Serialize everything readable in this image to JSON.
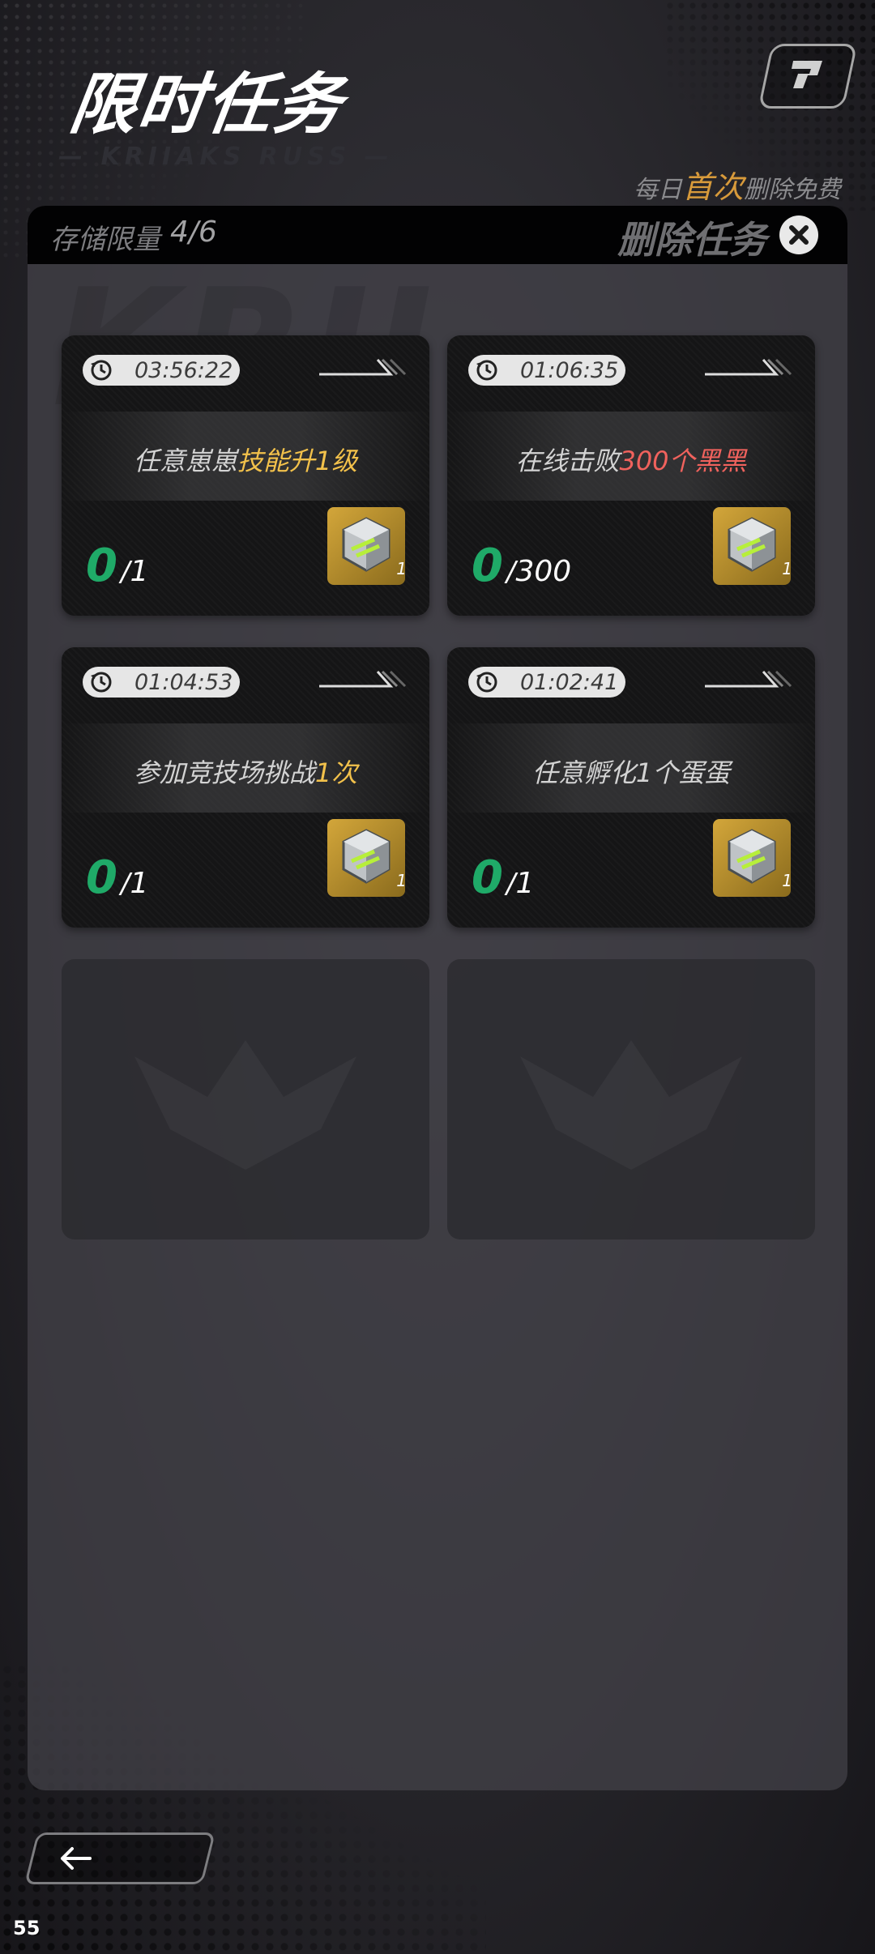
{
  "header": {
    "title": "限时任务",
    "subtitle_deco": "— KRIIAKS RUSS —",
    "daily_note_pre": "每日",
    "daily_note_hl": "首次",
    "daily_note_post": "删除免费"
  },
  "panel": {
    "storage_label": "存储限量",
    "storage_value": "4/6",
    "delete_label": "删除任务"
  },
  "tasks": [
    {
      "timer": "03:56:22",
      "desc_plain": "任意崽崽",
      "desc_hl": "技能升1级",
      "desc_hl_color": "yellow",
      "desc_tail": "",
      "progress_current": "0",
      "progress_total": "1",
      "reward_count": "1"
    },
    {
      "timer": "01:06:35",
      "desc_plain": "在线击败",
      "desc_hl": "300个黑黑",
      "desc_hl_color": "red",
      "desc_tail": "",
      "progress_current": "0",
      "progress_total": "300",
      "reward_count": "1"
    },
    {
      "timer": "01:04:53",
      "desc_plain": "参加竞技场挑战",
      "desc_hl": "1次",
      "desc_hl_color": "yellow",
      "desc_tail": "",
      "progress_current": "0",
      "progress_total": "1",
      "reward_count": "1"
    },
    {
      "timer": "01:02:41",
      "desc_plain": "任意孵化1个蛋蛋",
      "desc_hl": "",
      "desc_hl_color": "yellow",
      "desc_tail": "",
      "progress_current": "0",
      "progress_total": "1",
      "reward_count": "1"
    }
  ],
  "status": {
    "fps": "55"
  },
  "colors": {
    "progress_green": "#1faa68",
    "highlight_yellow": "#f2c14b",
    "highlight_red": "#f0625d",
    "accent_orange": "#d79a3b"
  },
  "icons": [
    "help-icon",
    "close-icon",
    "timer-icon",
    "reward-item-icon",
    "back-arrow-icon"
  ]
}
